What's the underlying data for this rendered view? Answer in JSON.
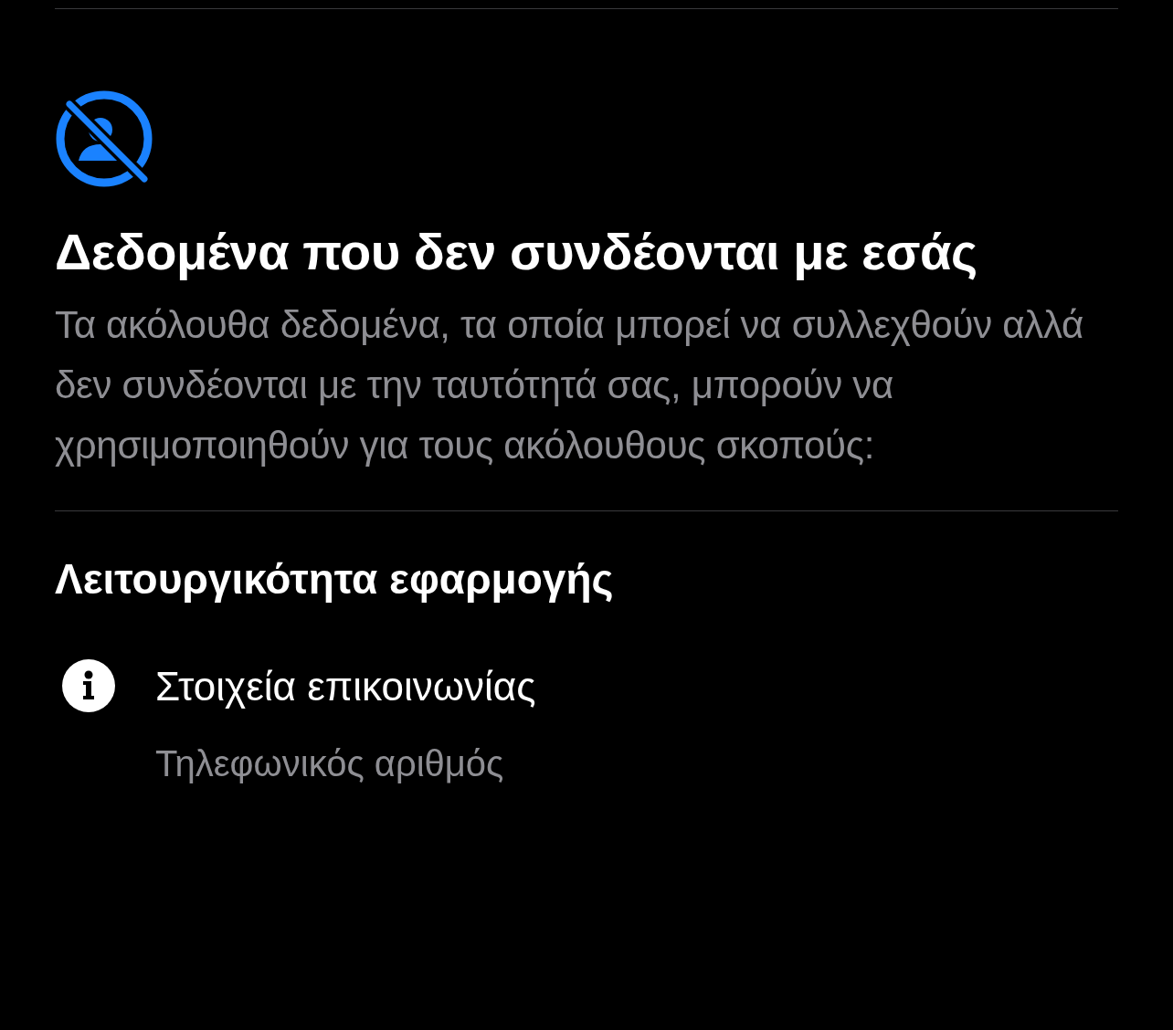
{
  "title": "Δεδομένα που δεν συνδέονται με εσάς",
  "description": "Τα ακόλουθα δεδομένα, τα οποία μπορεί να συλλεχθούν αλλά δεν συνδέονται με την ταυτότητά σας, μπορούν να χρησιμοποιηθούν για τους ακόλουθους σκοπούς:",
  "sections": [
    {
      "heading": "Λειτουργικότητα εφαρμογής",
      "items": [
        {
          "label": "Στοιχεία επικοινωνίας",
          "detail": "Τηλεφωνικός αριθμός"
        }
      ]
    }
  ]
}
